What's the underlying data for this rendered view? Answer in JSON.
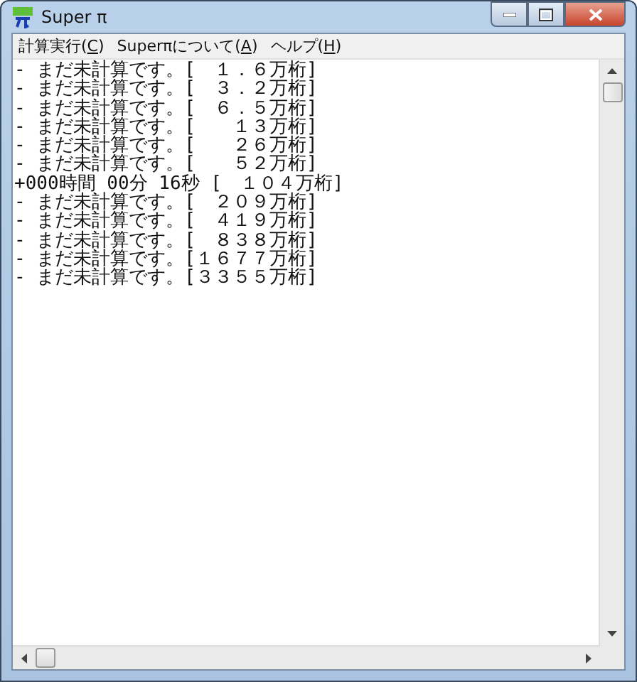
{
  "window": {
    "title": "Super π"
  },
  "menu": [
    {
      "before": "計算実行(",
      "key": "C",
      "after": ")"
    },
    {
      "before": "Superπについて(",
      "key": "A",
      "after": ")"
    },
    {
      "before": "ヘルプ(",
      "key": "H",
      "after": ")"
    }
  ],
  "lines": [
    "- まだ未計算です。[　１．６万桁]",
    "- まだ未計算です。[　３．２万桁]",
    "- まだ未計算です。[　６．５万桁]",
    "- まだ未計算です。[　　１３万桁]",
    "- まだ未計算です。[　　２６万桁]",
    "- まだ未計算です。[　　５２万桁]",
    "+000時間 00分 16秒 [　１０４万桁]",
    "- まだ未計算です。[　２０９万桁]",
    "- まだ未計算です。[　４１９万桁]",
    "- まだ未計算です。[　８３８万桁]",
    "- まだ未計算です。[１６７７万桁]",
    "- まだ未計算です。[３３５５万桁]"
  ]
}
